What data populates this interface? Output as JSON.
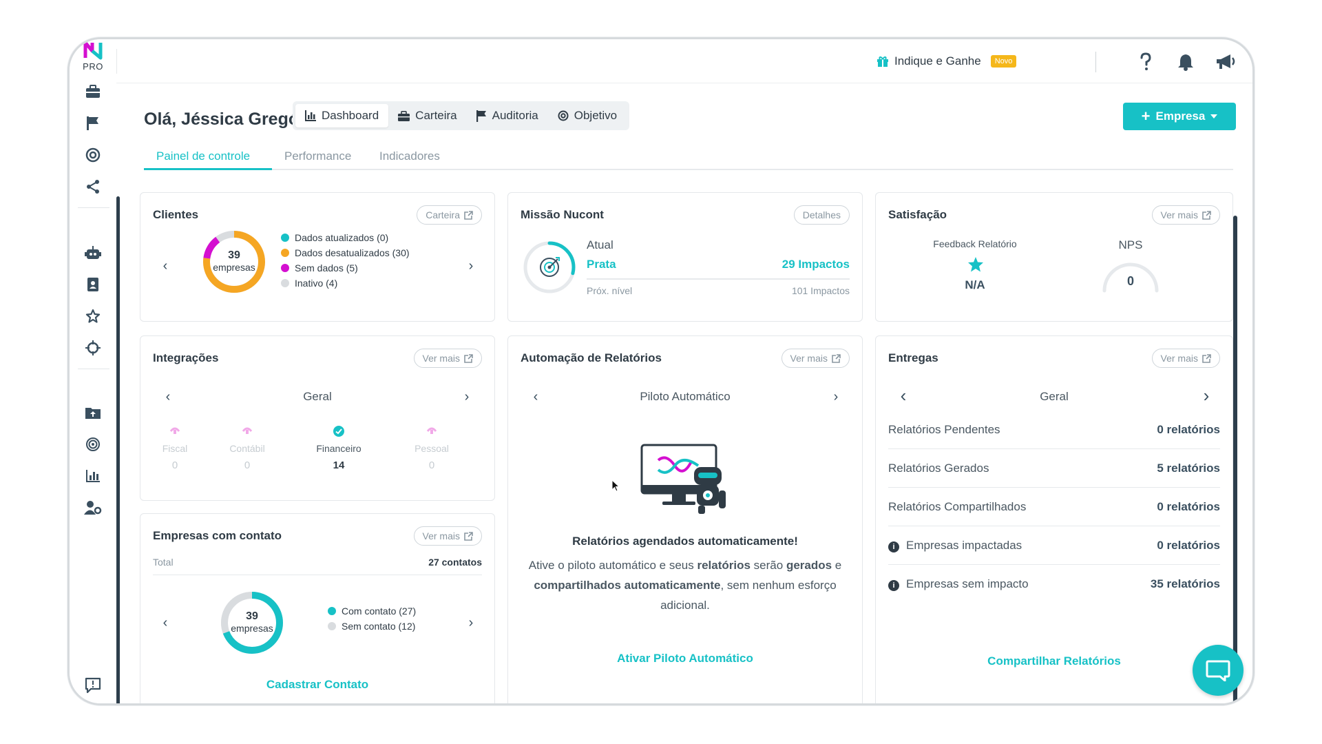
{
  "logo": {
    "tag": "PRO"
  },
  "topbar": {
    "referral_label": "Indique e Ganhe",
    "referral_badge": "Novo",
    "icons": [
      "gift-icon",
      "help-icon",
      "bell-icon",
      "megaphone-icon",
      "user-icon"
    ]
  },
  "sidebar": {
    "icons": [
      "briefcase-icon",
      "flag-icon",
      "target-icon",
      "share-icon",
      "robot-icon",
      "contact-book-icon",
      "star-icon",
      "crosshair-icon",
      "folder-upload-icon",
      "radar-icon",
      "bar-chart-icon",
      "user-settings-icon",
      "feedback-icon"
    ]
  },
  "header": {
    "greeting": "Olá, Jéssica Gregório",
    "nav": [
      {
        "label": "Dashboard",
        "icon": "chart-icon",
        "active": true
      },
      {
        "label": "Carteira",
        "icon": "briefcase-icon",
        "active": false
      },
      {
        "label": "Auditoria",
        "icon": "flag-icon",
        "active": false
      },
      {
        "label": "Objetivo",
        "icon": "target-icon",
        "active": false
      }
    ],
    "add_button": "Empresa"
  },
  "subtabs": [
    {
      "label": "Painel de controle",
      "active": true
    },
    {
      "label": "Performance",
      "active": false
    },
    {
      "label": "Indicadores",
      "active": false
    }
  ],
  "clientes": {
    "title": "Clientes",
    "button": "Carteira",
    "center_value": "39",
    "center_unit": "empresas",
    "legend": [
      {
        "label": "Dados atualizados (0)",
        "value": 0,
        "color": "#17c1c6"
      },
      {
        "label": "Dados desatualizados (30)",
        "value": 30,
        "color": "#f5a623"
      },
      {
        "label": "Sem dados (5)",
        "value": 5,
        "color": "#d40fd0"
      },
      {
        "label": "Inativo (4)",
        "value": 4,
        "color": "#d9dcdf"
      }
    ]
  },
  "missao": {
    "title": "Missão Nucont",
    "button": "Detalhes",
    "current_label": "Atual",
    "level": "Prata",
    "impacts": "29 Impactos",
    "next_label": "Próx. nível",
    "next_impacts": "101 Impactos",
    "progress": 0.29
  },
  "satisfacao": {
    "title": "Satisfação",
    "button": "Ver mais",
    "feedback_label": "Feedback Relatório",
    "feedback_value": "N/A",
    "nps_label": "NPS",
    "nps_value": "0"
  },
  "integracoes": {
    "title": "Integrações",
    "button": "Ver mais",
    "selector": "Geral",
    "items": [
      {
        "label": "Fiscal",
        "value": "0",
        "active": false
      },
      {
        "label": "Contábil",
        "value": "0",
        "active": false
      },
      {
        "label": "Financeiro",
        "value": "14",
        "active": true
      },
      {
        "label": "Pessoal",
        "value": "0",
        "active": false
      }
    ]
  },
  "automacao": {
    "title": "Automação de Relatórios",
    "button": "Ver mais",
    "selector": "Piloto Automático",
    "headline": "Relatórios agendados automaticamente!",
    "desc_1": "Ative o piloto automático e seus ",
    "desc_b1": "relatórios",
    "desc_2": " serão ",
    "desc_b2": "gerados",
    "desc_3": " e ",
    "desc_b3": "compartilhados automaticamente",
    "desc_4": ", sem nenhum esforço adicional.",
    "cta": "Ativar Piloto Automático"
  },
  "entregas": {
    "title": "Entregas",
    "button": "Ver mais",
    "selector": "Geral",
    "rows": [
      {
        "label": "Relatórios Pendentes",
        "value": "0 relatórios",
        "info": false
      },
      {
        "label": "Relatórios Gerados",
        "value": "5 relatórios",
        "info": false
      },
      {
        "label": "Relatórios Compartilhados",
        "value": "0 relatórios",
        "info": false
      },
      {
        "label": "Empresas impactadas",
        "value": "0 relatórios",
        "info": true
      },
      {
        "label": "Empresas sem impacto",
        "value": "35 relatórios",
        "info": true
      }
    ],
    "cta": "Compartilhar Relatórios"
  },
  "contato": {
    "title": "Empresas com contato",
    "button": "Ver mais",
    "total_label": "Total",
    "total_value": "27 contatos",
    "center_value": "39",
    "center_unit": "empresas",
    "legend": [
      {
        "label": "Com contato (27)",
        "value": 27,
        "color": "#17c1c6"
      },
      {
        "label": "Sem contato (12)",
        "value": 12,
        "color": "#d9dcdf"
      }
    ],
    "cta": "Cadastrar Contato"
  },
  "colors": {
    "accent": "#17c1c6",
    "dark": "#2d3e4c",
    "warning": "#f5a623",
    "magenta": "#d40fd0"
  }
}
